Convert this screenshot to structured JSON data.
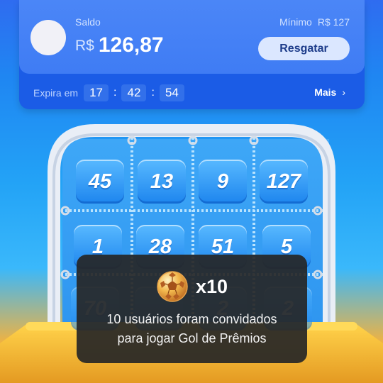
{
  "wallet": {
    "balance_label": "Saldo",
    "currency": "R$",
    "balance": "126,87",
    "minimum_label": "Mínimo",
    "minimum_value": "R$ 127",
    "redeem_label": "Resgatar"
  },
  "expiry": {
    "label": "Expira em",
    "hours": "17",
    "minutes": "42",
    "seconds": "54",
    "separator": ":",
    "more_label": "Mais",
    "more_icon": "chevron-right-icon"
  },
  "board": {
    "row1": [
      "45",
      "13",
      "9",
      "127"
    ],
    "row2": [
      "1",
      "28",
      "51",
      "5"
    ],
    "row3": [
      "70",
      "",
      "2",
      "2"
    ]
  },
  "toast": {
    "icon": "gold-soccer-ball-icon",
    "multiplier": "x10",
    "line1": "10 usuários foram convidados",
    "line2": "para jogar Gol de Prêmios"
  },
  "colors": {
    "wallet_card": "#3f7cf4",
    "wallet_footer": "#1b5ce6",
    "redeem_button": "#dbe7ff",
    "tile": "#2f95f4",
    "toast_background": "#262626"
  }
}
